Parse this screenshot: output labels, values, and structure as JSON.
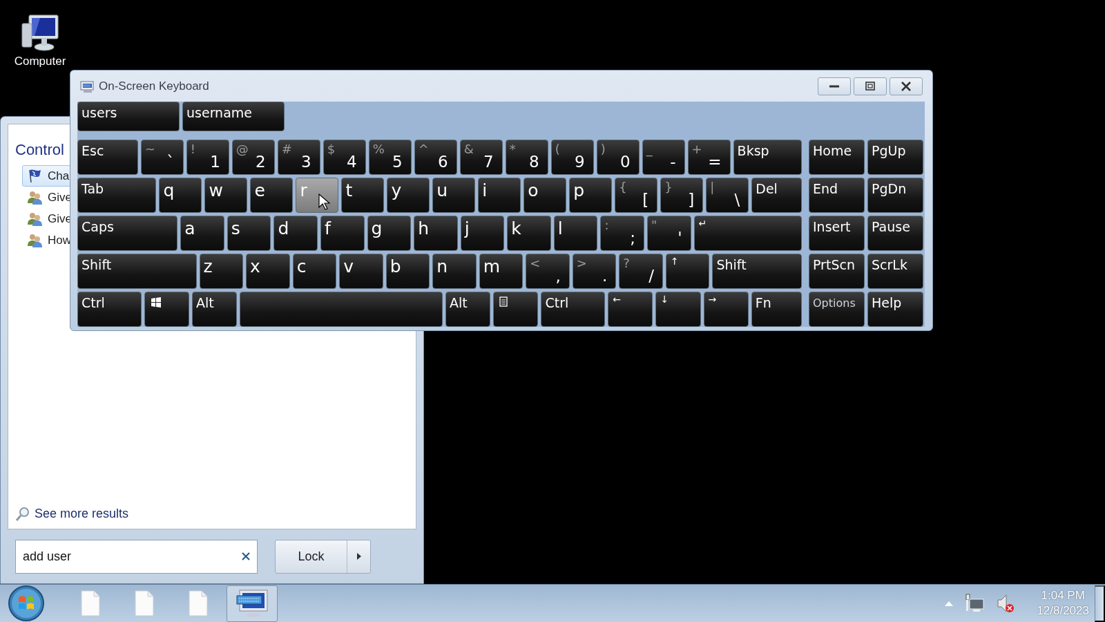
{
  "desktop": {
    "icons": [
      {
        "label": "Computer"
      }
    ]
  },
  "start_menu": {
    "group_title": "Control",
    "items": [
      {
        "label": "Cha",
        "kind": "flag",
        "selected": true
      },
      {
        "label": "Give",
        "kind": "users",
        "selected": false
      },
      {
        "label": "Give",
        "kind": "users",
        "selected": false
      },
      {
        "label": "How",
        "kind": "users",
        "selected": false
      }
    ],
    "see_more": "See more results",
    "search": {
      "value": "add user"
    },
    "power_button": "Lock"
  },
  "keyboard": {
    "title": "On-Screen Keyboard",
    "predictions": [
      "users",
      "username"
    ],
    "rows": [
      {
        "keys": [
          {
            "kind": "fn",
            "label": "Esc",
            "hover": false
          },
          {
            "kind": "dual",
            "shift": "~",
            "label": "`",
            "hover": false
          },
          {
            "kind": "dual",
            "shift": "!",
            "label": "1",
            "hover": false
          },
          {
            "kind": "dual",
            "shift": "@",
            "label": "2",
            "hover": false
          },
          {
            "kind": "dual",
            "shift": "#",
            "label": "3",
            "hover": false
          },
          {
            "kind": "dual",
            "shift": "$",
            "label": "4",
            "hover": false
          },
          {
            "kind": "dual",
            "shift": "%",
            "label": "5",
            "hover": false
          },
          {
            "kind": "dual",
            "shift": "^",
            "label": "6",
            "hover": false
          },
          {
            "kind": "dual",
            "shift": "&",
            "label": "7",
            "hover": false
          },
          {
            "kind": "dual",
            "shift": "*",
            "label": "8",
            "hover": false
          },
          {
            "kind": "dual",
            "shift": "(",
            "label": "9",
            "hover": false
          },
          {
            "kind": "dual",
            "shift": ")",
            "label": "0",
            "hover": false
          },
          {
            "kind": "dual",
            "shift": "_",
            "label": "-",
            "hover": false
          },
          {
            "kind": "dual",
            "shift": "+",
            "label": "=",
            "hover": false
          },
          {
            "kind": "fn",
            "label": "Bksp",
            "hover": false
          }
        ]
      },
      {
        "keys": [
          {
            "kind": "fn",
            "label": "Tab",
            "hover": false
          },
          {
            "kind": "letter",
            "label": "q",
            "hover": false
          },
          {
            "kind": "letter",
            "label": "w",
            "hover": false
          },
          {
            "kind": "letter",
            "label": "e",
            "hover": false
          },
          {
            "kind": "letter",
            "label": "r",
            "hover": true
          },
          {
            "kind": "letter",
            "label": "t",
            "hover": false
          },
          {
            "kind": "letter",
            "label": "y",
            "hover": false
          },
          {
            "kind": "letter",
            "label": "u",
            "hover": false
          },
          {
            "kind": "letter",
            "label": "i",
            "hover": false
          },
          {
            "kind": "letter",
            "label": "o",
            "hover": false
          },
          {
            "kind": "letter",
            "label": "p",
            "hover": false
          },
          {
            "kind": "dual",
            "shift": "{",
            "label": "[",
            "hover": false
          },
          {
            "kind": "dual",
            "shift": "}",
            "label": "]",
            "hover": false
          },
          {
            "kind": "dual",
            "shift": "|",
            "label": "\\",
            "hover": false
          },
          {
            "kind": "fn",
            "label": "Del",
            "hover": false
          }
        ]
      },
      {
        "keys": [
          {
            "kind": "fn",
            "label": "Caps",
            "hover": false
          },
          {
            "kind": "letter",
            "label": "a",
            "hover": false
          },
          {
            "kind": "letter",
            "label": "s",
            "hover": false
          },
          {
            "kind": "letter",
            "label": "d",
            "hover": false
          },
          {
            "kind": "letter",
            "label": "f",
            "hover": false
          },
          {
            "kind": "letter",
            "label": "g",
            "hover": false
          },
          {
            "kind": "letter",
            "label": "h",
            "hover": false
          },
          {
            "kind": "letter",
            "label": "j",
            "hover": false
          },
          {
            "kind": "letter",
            "label": "k",
            "hover": false
          },
          {
            "kind": "letter",
            "label": "l",
            "hover": false
          },
          {
            "kind": "dual",
            "shift": ":",
            "label": ";",
            "hover": false
          },
          {
            "kind": "dual",
            "shift": "\"",
            "label": "'",
            "hover": false
          },
          {
            "kind": "glyph",
            "label": "↵",
            "hover": false
          }
        ]
      },
      {
        "keys": [
          {
            "kind": "fn",
            "label": "Shift",
            "hover": false
          },
          {
            "kind": "letter",
            "label": "z",
            "hover": false
          },
          {
            "kind": "letter",
            "label": "x",
            "hover": false
          },
          {
            "kind": "letter",
            "label": "c",
            "hover": false
          },
          {
            "kind": "letter",
            "label": "v",
            "hover": false
          },
          {
            "kind": "letter",
            "label": "b",
            "hover": false
          },
          {
            "kind": "letter",
            "label": "n",
            "hover": false
          },
          {
            "kind": "letter",
            "label": "m",
            "hover": false
          },
          {
            "kind": "dual",
            "shift": "<",
            "label": ",",
            "hover": false
          },
          {
            "kind": "dual",
            "shift": ">",
            "label": ".",
            "hover": false
          },
          {
            "kind": "dual",
            "shift": "?",
            "label": "/",
            "hover": false
          },
          {
            "kind": "glyph",
            "label": "↑",
            "hover": false
          },
          {
            "kind": "fn",
            "label": "Shift",
            "hover": false
          }
        ]
      },
      {
        "keys": [
          {
            "kind": "fn",
            "label": "Ctrl",
            "hover": false
          },
          {
            "kind": "winkey",
            "hover": false
          },
          {
            "kind": "fn",
            "label": "Alt",
            "hover": false
          },
          {
            "kind": "space",
            "hover": false
          },
          {
            "kind": "fn",
            "label": "Alt",
            "hover": false
          },
          {
            "kind": "menukey",
            "hover": false
          },
          {
            "kind": "fn",
            "label": "Ctrl",
            "hover": false
          },
          {
            "kind": "glyph",
            "label": "←",
            "hover": false
          },
          {
            "kind": "glyph",
            "label": "↓",
            "hover": false
          },
          {
            "kind": "glyph",
            "label": "→",
            "hover": false
          },
          {
            "kind": "fn",
            "label": "Fn",
            "hover": false
          }
        ]
      }
    ],
    "nav_rows": [
      {
        "keys": [
          {
            "kind": "fn",
            "label": "Home"
          },
          {
            "kind": "fn",
            "label": "PgUp"
          }
        ]
      },
      {
        "keys": [
          {
            "kind": "fn",
            "label": "End"
          },
          {
            "kind": "fn",
            "label": "PgDn"
          }
        ]
      },
      {
        "keys": [
          {
            "kind": "fn",
            "label": "Insert"
          },
          {
            "kind": "fn",
            "label": "Pause"
          }
        ]
      },
      {
        "keys": [
          {
            "kind": "fn",
            "label": "PrtScn"
          },
          {
            "kind": "fn",
            "label": "ScrLk"
          }
        ]
      },
      {
        "keys": [
          {
            "kind": "setting",
            "label": "Options"
          },
          {
            "kind": "fn",
            "label": "Help"
          }
        ]
      }
    ]
  },
  "taskbar": {
    "items": [
      {
        "kind": "document",
        "selected": false
      },
      {
        "kind": "document",
        "selected": false
      },
      {
        "kind": "document",
        "selected": false
      },
      {
        "kind": "keyboard",
        "selected": true
      }
    ],
    "tray": {
      "volume_muted": true
    },
    "clock": {
      "time": "1:04 PM",
      "date": "12/8/2023"
    }
  }
}
